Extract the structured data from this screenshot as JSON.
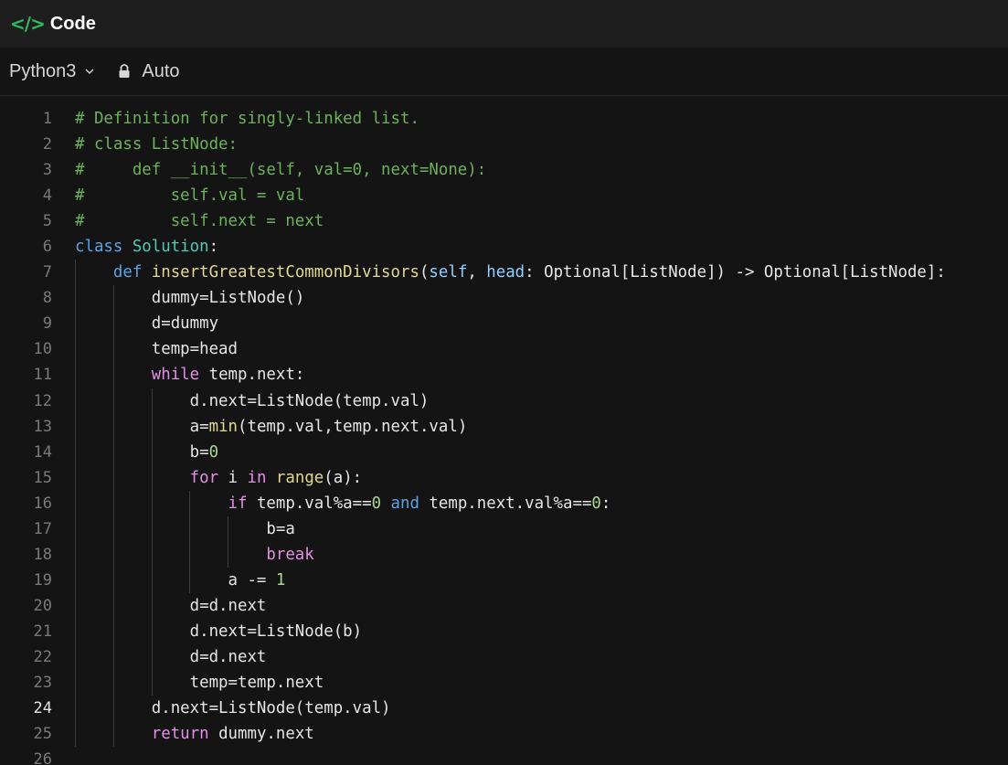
{
  "panel": {
    "title": "Code",
    "language": "Python3",
    "mode": "Auto"
  },
  "editor": {
    "active_line": 24,
    "lines": [
      {
        "n": "1",
        "indent": 0,
        "tokens": [
          {
            "t": "# Definition for singly-linked list.",
            "c": "cm"
          }
        ]
      },
      {
        "n": "2",
        "indent": 0,
        "tokens": [
          {
            "t": "# class ListNode:",
            "c": "cm"
          }
        ]
      },
      {
        "n": "3",
        "indent": 0,
        "tokens": [
          {
            "t": "#     def __init__(self, val=0, next=None):",
            "c": "cm"
          }
        ]
      },
      {
        "n": "4",
        "indent": 0,
        "tokens": [
          {
            "t": "#         self.val = val",
            "c": "cm"
          }
        ]
      },
      {
        "n": "5",
        "indent": 0,
        "tokens": [
          {
            "t": "#         self.next = next",
            "c": "cm"
          }
        ]
      },
      {
        "n": "6",
        "indent": 0,
        "tokens": [
          {
            "t": "class ",
            "c": "kw2"
          },
          {
            "t": "Solution",
            "c": "cls"
          },
          {
            "t": ":",
            "c": ""
          }
        ]
      },
      {
        "n": "7",
        "indent": 1,
        "tokens": [
          {
            "t": "    def ",
            "c": "kw2"
          },
          {
            "t": "insertGreatestCommonDivisors",
            "c": "fn"
          },
          {
            "t": "(",
            "c": ""
          },
          {
            "t": "self",
            "c": "param"
          },
          {
            "t": ", ",
            "c": ""
          },
          {
            "t": "head",
            "c": "param"
          },
          {
            "t": ": Optional[ListNode]) -> Optional[ListNode]:",
            "c": ""
          }
        ]
      },
      {
        "n": "8",
        "indent": 2,
        "tokens": [
          {
            "t": "        dummy=",
            "c": ""
          },
          {
            "t": "ListNode",
            "c": ""
          },
          {
            "t": "()",
            "c": ""
          }
        ]
      },
      {
        "n": "9",
        "indent": 2,
        "tokens": [
          {
            "t": "        d=dummy",
            "c": ""
          }
        ]
      },
      {
        "n": "10",
        "indent": 2,
        "tokens": [
          {
            "t": "        temp=head",
            "c": ""
          }
        ]
      },
      {
        "n": "11",
        "indent": 2,
        "tokens": [
          {
            "t": "        while ",
            "c": "kw"
          },
          {
            "t": "temp.next:",
            "c": ""
          }
        ]
      },
      {
        "n": "12",
        "indent": 3,
        "tokens": [
          {
            "t": "            d.next=ListNode(temp.val)",
            "c": ""
          }
        ]
      },
      {
        "n": "13",
        "indent": 3,
        "tokens": [
          {
            "t": "            a=",
            "c": ""
          },
          {
            "t": "min",
            "c": "fn"
          },
          {
            "t": "(temp.val,temp.next.val)",
            "c": ""
          }
        ]
      },
      {
        "n": "14",
        "indent": 3,
        "tokens": [
          {
            "t": "            b=",
            "c": ""
          },
          {
            "t": "0",
            "c": "num"
          }
        ]
      },
      {
        "n": "15",
        "indent": 3,
        "tokens": [
          {
            "t": "            for ",
            "c": "kw"
          },
          {
            "t": "i ",
            "c": ""
          },
          {
            "t": "in ",
            "c": "kw"
          },
          {
            "t": "range",
            "c": "fn"
          },
          {
            "t": "(a):",
            "c": ""
          }
        ]
      },
      {
        "n": "16",
        "indent": 4,
        "tokens": [
          {
            "t": "                if ",
            "c": "kw"
          },
          {
            "t": "temp.val%a==",
            "c": ""
          },
          {
            "t": "0",
            "c": "num"
          },
          {
            "t": " and ",
            "c": "kw2"
          },
          {
            "t": "temp.next.val%a==",
            "c": ""
          },
          {
            "t": "0",
            "c": "num"
          },
          {
            "t": ":",
            "c": ""
          }
        ]
      },
      {
        "n": "17",
        "indent": 5,
        "tokens": [
          {
            "t": "                    b=a",
            "c": ""
          }
        ]
      },
      {
        "n": "18",
        "indent": 5,
        "tokens": [
          {
            "t": "                    break",
            "c": "kw"
          }
        ]
      },
      {
        "n": "19",
        "indent": 4,
        "tokens": [
          {
            "t": "                a -= ",
            "c": ""
          },
          {
            "t": "1",
            "c": "num"
          }
        ]
      },
      {
        "n": "20",
        "indent": 3,
        "tokens": [
          {
            "t": "            d=d.next",
            "c": ""
          }
        ]
      },
      {
        "n": "21",
        "indent": 3,
        "tokens": [
          {
            "t": "            d.next=ListNode(b)",
            "c": ""
          }
        ]
      },
      {
        "n": "22",
        "indent": 3,
        "tokens": [
          {
            "t": "            d=d.next",
            "c": ""
          }
        ]
      },
      {
        "n": "23",
        "indent": 3,
        "tokens": [
          {
            "t": "            temp=temp.next",
            "c": ""
          }
        ]
      },
      {
        "n": "24",
        "indent": 2,
        "tokens": [
          {
            "t": "        d.next=ListNode(temp.val)",
            "c": ""
          }
        ]
      },
      {
        "n": "25",
        "indent": 2,
        "tokens": [
          {
            "t": "        return ",
            "c": "kw"
          },
          {
            "t": "dummy.next",
            "c": ""
          }
        ]
      },
      {
        "n": "26",
        "indent": 0,
        "tokens": []
      }
    ]
  }
}
